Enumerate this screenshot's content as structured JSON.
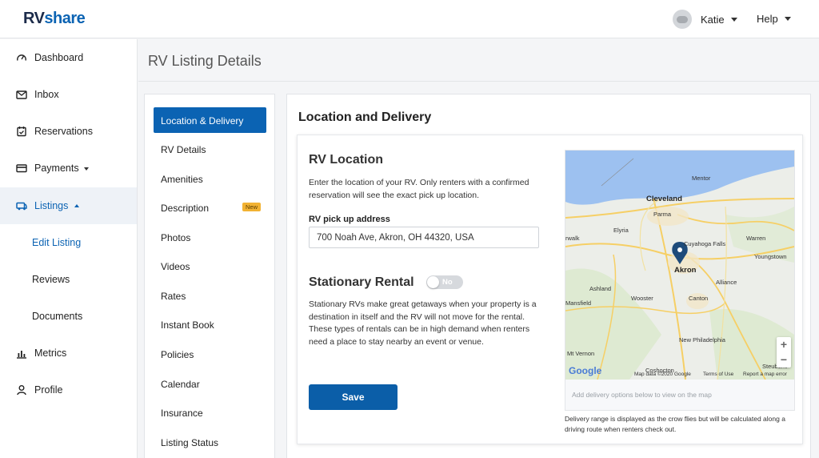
{
  "brand": {
    "part1": "RV",
    "part2": "share"
  },
  "header": {
    "user_name": "Katie",
    "help_label": "Help"
  },
  "sidebar": {
    "items": [
      {
        "label": "Dashboard",
        "icon": "dashboard-icon"
      },
      {
        "label": "Inbox",
        "icon": "inbox-icon"
      },
      {
        "label": "Reservations",
        "icon": "reservations-icon"
      },
      {
        "label": "Payments",
        "icon": "payments-icon"
      },
      {
        "label": "Listings",
        "icon": "listings-icon"
      },
      {
        "label": "Edit Listing"
      },
      {
        "label": "Reviews"
      },
      {
        "label": "Documents"
      },
      {
        "label": "Metrics",
        "icon": "metrics-icon"
      },
      {
        "label": "Profile",
        "icon": "profile-icon"
      }
    ]
  },
  "page": {
    "title": "RV Listing Details"
  },
  "subnav": {
    "items": [
      "Location & Delivery",
      "RV Details",
      "Amenities",
      "Description",
      "Photos",
      "Videos",
      "Rates",
      "Instant Book",
      "Policies",
      "Calendar",
      "Insurance",
      "Listing Status"
    ],
    "new_badge": "New"
  },
  "panel": {
    "title": "Location and Delivery",
    "rv_location": {
      "title": "RV Location",
      "description": "Enter the location of your RV. Only renters with a confirmed reservation will see the exact pick up location.",
      "address_label": "RV pick up address",
      "address_value": "700 Noah Ave, Akron, OH 44320, USA"
    },
    "stationary": {
      "title": "Stationary Rental",
      "toggle_text": "No",
      "description": "Stationary RVs make great getaways when your property is a destination in itself and the RV will not move for the rental. These types of rentals can be in high demand when renters need a place to stay nearby an event or venue."
    },
    "save_label": "Save",
    "map": {
      "cities": {
        "cleveland": "Cleveland",
        "mentor": "Mentor",
        "parma": "Parma",
        "elyria": "Elyria",
        "warren": "Warren",
        "youngstown": "Youngstown",
        "akron": "Akron",
        "ashland": "Ashland",
        "wooster": "Wooster",
        "canton": "Canton",
        "mansfield": "Mansfield",
        "alliance": "Alliance",
        "new_philadelphia": "New Philadelphia",
        "mt_vernon": "Mt Vernon",
        "coshocton": "Coshocton",
        "steubenville": "Steubenv",
        "cuyahoga_falls": "Cuyahoga Falls",
        "norwalk": "rwalk"
      },
      "google": "Google",
      "attr_data": "Map data ©2020 Google",
      "attr_terms": "Terms of Use",
      "attr_report": "Report a map error",
      "zoom_in": "+",
      "zoom_out": "−",
      "delivery_note": "Add delivery options below to view on the map"
    },
    "map_footer": "Delivery range is displayed as the crow flies but will be calculated along a driving route when renters check out."
  }
}
